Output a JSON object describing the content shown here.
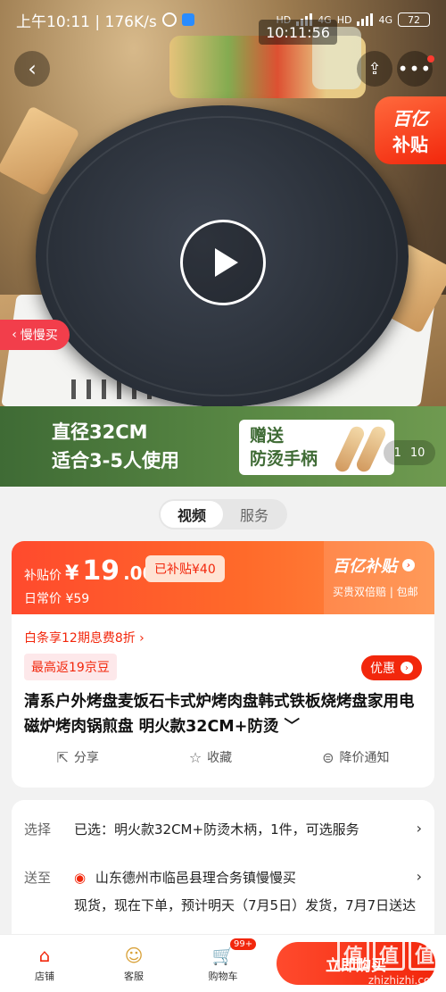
{
  "status_bar": {
    "time_carrier": "上午10:11 | 176K/s",
    "net_labels": [
      "HD",
      "4G",
      "HD",
      "4G"
    ],
    "battery": "72"
  },
  "video_time": "10:11:56",
  "hero": {
    "subsidy_line1": "百亿",
    "subsidy_line2": "补贴",
    "slow_buy": "慢慢买",
    "banner_line1": "直径32CM",
    "banner_line2": "适合3-5人使用",
    "gift_line1": "赠送",
    "gift_line2": "防烫手柄",
    "counter_current": "1",
    "counter_total": "10"
  },
  "media_tabs": [
    {
      "label": "视频",
      "active": true
    },
    {
      "label": "服务",
      "active": false
    }
  ],
  "price": {
    "label": "补贴价",
    "symbol": "¥",
    "int": "19",
    "dec": ".00",
    "subsidy_pill": "已补贴¥40",
    "daily": "日常价 ¥59",
    "hb_title": "百亿补贴",
    "hb_sub": "买贵双倍赔 | 包邮",
    "baitiao": "白条享12期息费8折 ›",
    "jingdou": "最高返19京豆",
    "coupon": "优惠",
    "title": "清系户外烤盘麦饭石卡式炉烤肉盘韩式铁板烧烤盘家用电磁炉烤肉锅煎盘 明火款32CM+防烫 ﹀"
  },
  "actions": [
    {
      "icon": "share-icon",
      "label": "分享"
    },
    {
      "icon": "star-icon",
      "label": "收藏"
    },
    {
      "icon": "price-bell-icon",
      "label": "降价通知"
    }
  ],
  "details": {
    "select_label": "选择",
    "select_value": "已选：明火款32CM+防烫木柄，1件，可选服务",
    "ship_label": "送至",
    "ship_value": "山东德州市临邑县理合务镇慢慢买",
    "stock": "现货，现在下单，预计明天（7月5日）发货，7月7日送达"
  },
  "bottom": {
    "store": "店铺",
    "service": "客服",
    "cart": "购物车",
    "cart_count": "99+",
    "buy": "立即购买"
  },
  "watermark": {
    "logo": [
      "值",
      "值",
      "值"
    ],
    "site": "zhizhizhi.com"
  },
  "colors": {
    "accent": "#f2270c",
    "price_bg": "#ff4a2d",
    "banner_green": "#4f7c3e"
  }
}
